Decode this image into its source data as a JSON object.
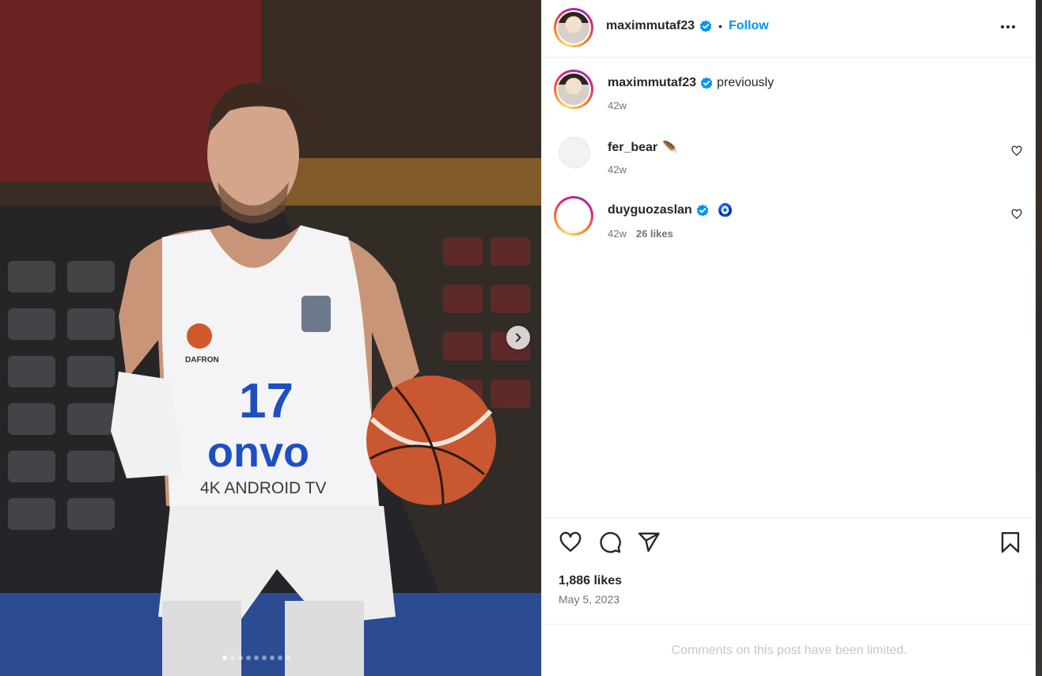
{
  "post": {
    "author": "maximmutaf23",
    "follow_label": "Follow",
    "separator": "•",
    "carousel": {
      "slide_count": 9,
      "active_slide": 1
    },
    "photo_text": {
      "jersey_number": "17",
      "sponsor": "onvo",
      "sponsor_sub": "4K ANDROID TV",
      "kit_brand": "DAFRON"
    }
  },
  "caption": {
    "user": "maximmutaf23",
    "text": "previously",
    "age": "42w"
  },
  "comments": [
    {
      "user": "fer_bear",
      "emoji": "🪶",
      "age": "42w",
      "likes": ""
    },
    {
      "user": "duyguozaslan",
      "emoji": "🧿",
      "age": "42w",
      "likes": "26 likes"
    }
  ],
  "footer": {
    "likes": "1,886 likes",
    "date": "May 5, 2023",
    "comments_notice": "Comments on this post have been limited."
  },
  "icons": {
    "verified": "verified-badge-icon",
    "more": "more-options-icon",
    "like": "heart-icon",
    "comment": "comment-icon",
    "share": "share-icon",
    "save": "bookmark-icon",
    "next": "chevron-right-icon"
  },
  "colors": {
    "accent": "#0095f6",
    "verified": "#0095f6",
    "text": "#262626",
    "muted": "#737373"
  }
}
